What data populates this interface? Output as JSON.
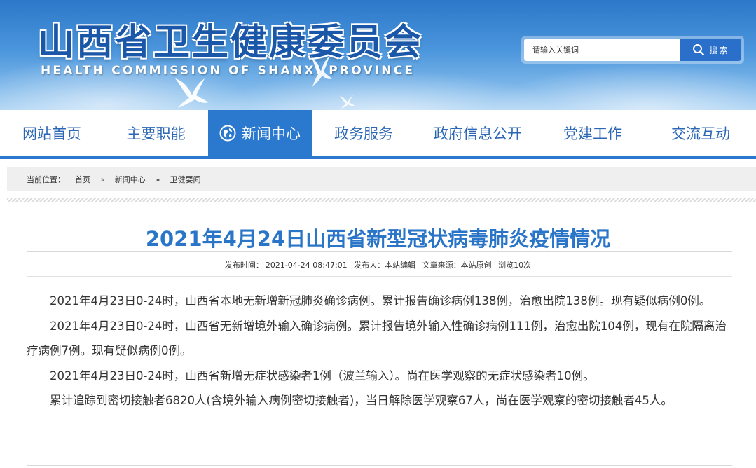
{
  "header": {
    "site_title": "山西省卫生健康委员会",
    "site_subtitle": "HEALTH COMMISSION OF SHANXI PROVINCE",
    "search_placeholder": "请输入关键词",
    "search_button": "搜索",
    "search_icon": "magnifier-icon",
    "decor_icon": "dove-icon"
  },
  "nav": {
    "items": [
      {
        "label": "网站首页"
      },
      {
        "label": "主要职能"
      },
      {
        "label": "新闻中心",
        "icon": "globe-icon",
        "active": true
      },
      {
        "label": "政务服务"
      },
      {
        "label": "政府信息公开"
      },
      {
        "label": "党建工作"
      },
      {
        "label": "交流互动"
      }
    ]
  },
  "breadcrumb": {
    "prefix": "当前位置：",
    "items": [
      "首页",
      "新闻中心",
      "卫健要闻"
    ],
    "separator": "»"
  },
  "article": {
    "title": "2021年4月24日山西省新型冠状病毒肺炎疫情情况",
    "meta": {
      "publish_label": "发布时间：",
      "publish_time": "2021-04-24 08:47:01",
      "publisher_label": "发布人：",
      "publisher": "本站编辑",
      "source_label": "文章来源：",
      "source": "本站原创",
      "views": "浏览10次"
    },
    "paragraphs": [
      "2021年4月23日0-24时，山西省本地无新增新冠肺炎确诊病例。累计报告确诊病例138例，治愈出院138例。现有疑似病例0例。",
      "2021年4月23日0-24时，山西省无新增境外输入确诊病例。累计报告境外输入性确诊病例111例，治愈出院104例，现有在院隔离治疗病例7例。现有疑似病例0例。",
      "2021年4月23日0-24时，山西省新增无症状感染者1例（波兰输入）。尚在医学观察的无症状感染者10例。",
      "累计追踪到密切接触者6820人(含境外输入病例密切接触者)，当日解除医学观察67人，尚在医学观察的密切接触者45人。"
    ]
  },
  "colors": {
    "brand_blue": "#2b79cf",
    "title_blue": "#2a75c8",
    "nav_text": "#2b67b5"
  }
}
